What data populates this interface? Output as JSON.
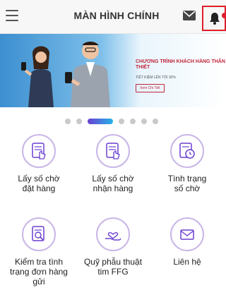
{
  "header": {
    "title": "MÀN HÌNH CHÍNH",
    "menu_icon": "hamburger-icon",
    "mail_icon": "mail-icon",
    "bell_icon": "bell-icon"
  },
  "banner": {
    "headline": "CHƯƠNG TRÌNH KHÁCH HÀNG THÂN THIẾT",
    "subtitle": "TIẾT KIỆM LÊN TỚI 30%",
    "cta": "Xem Chi Tiết"
  },
  "carousel": {
    "total": 7,
    "active_index": 2
  },
  "tiles": [
    {
      "label": "Lấy số chờ\nđặt hàng",
      "icon": "order-ticket-icon"
    },
    {
      "label": "Lấy số chờ\nnhận hàng",
      "icon": "pickup-ticket-icon"
    },
    {
      "label": "Tình trạng\nsố chờ",
      "icon": "queue-status-icon"
    },
    {
      "label": "Kiểm tra tình\ntrạng đơn hàng\ngửi",
      "icon": "order-check-icon"
    },
    {
      "label": "Quỹ phẫu thuật\ntim FFG",
      "icon": "heart-fund-icon"
    },
    {
      "label": "Liên hệ",
      "icon": "contact-mail-icon"
    }
  ],
  "colors": {
    "accent": "#6a3fd1",
    "highlight": "#e11d2a",
    "banner_red": "#c0263c"
  }
}
